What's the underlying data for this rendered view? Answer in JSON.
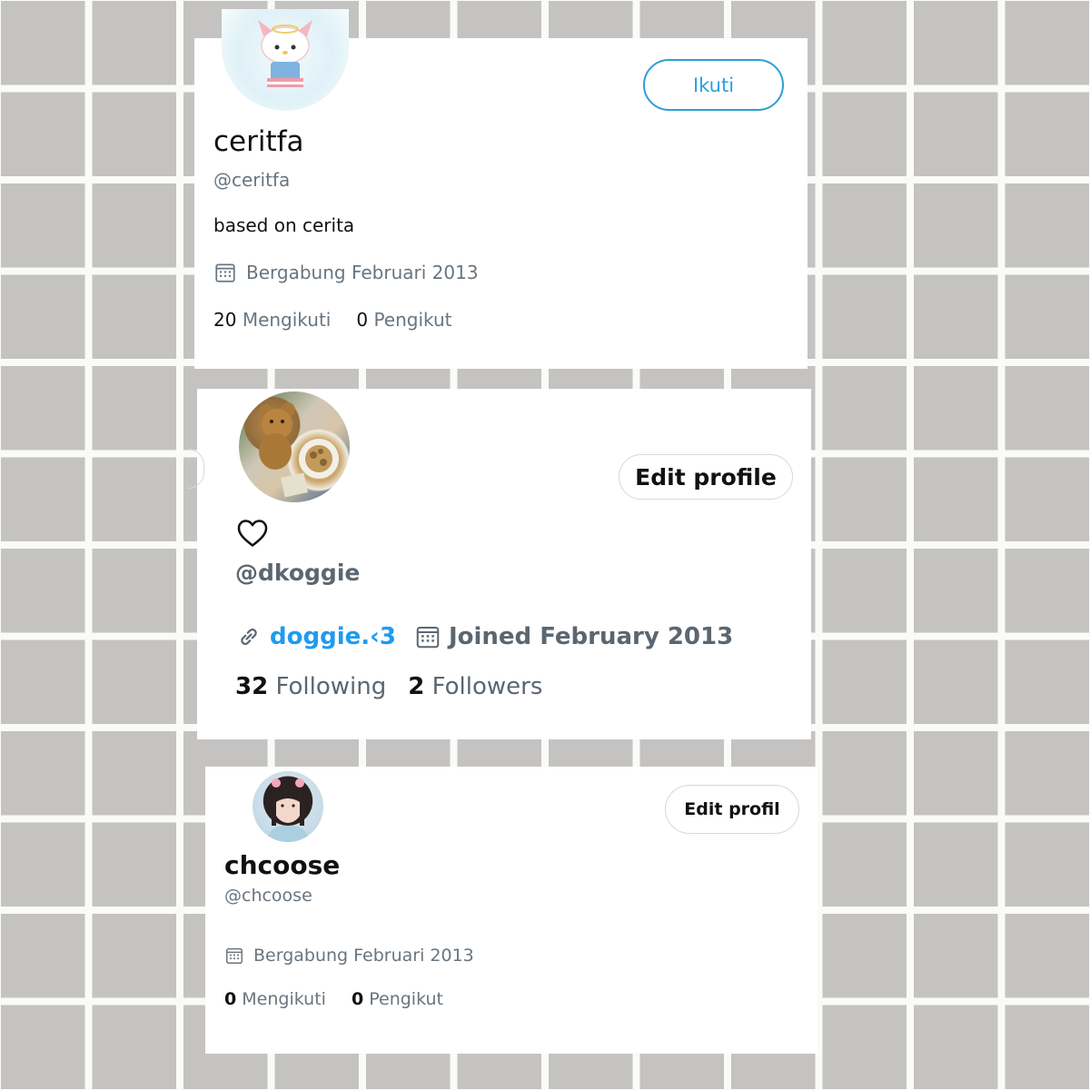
{
  "colors": {
    "accent": "#2e9fd8",
    "link": "#1d9bf0",
    "muted": "#69757f",
    "text": "#111111",
    "background_tiles": "#c4c3c1",
    "grout": "#fafaf9"
  },
  "profile_1": {
    "avatar_icon": "hello-kitty-avatar",
    "follow_label": "Ikuti",
    "name": "ceritfa",
    "handle": "@ceritfa",
    "bio": "based on cerita",
    "joined_icon": "calendar-icon",
    "joined": "Bergabung Februari 2013",
    "following_count": "20",
    "following_label": "Mengikuti",
    "followers_count": "0",
    "followers_label": "Pengikut"
  },
  "profile_2": {
    "avatar_icon": "teddy-bear-avatar",
    "edit_label": "Edit profile",
    "name_icon": "heart-outline-icon",
    "handle": "@dkoggie",
    "link_icon": "link-icon",
    "link_text": "doggie.‹3",
    "joined_icon": "calendar-icon",
    "joined": "Joined February 2013",
    "following_count": "32",
    "following_label": "Following",
    "followers_count": "2",
    "followers_label": "Followers"
  },
  "profile_3": {
    "avatar_icon": "girl-photo-avatar",
    "edit_label": "Edit profil",
    "name": "chcoose",
    "handle": "@chcoose",
    "joined_icon": "calendar-icon",
    "joined": "Bergabung Februari 2013",
    "following_count": "0",
    "following_label": "Mengikuti",
    "followers_count": "0",
    "followers_label": "Pengikut"
  }
}
